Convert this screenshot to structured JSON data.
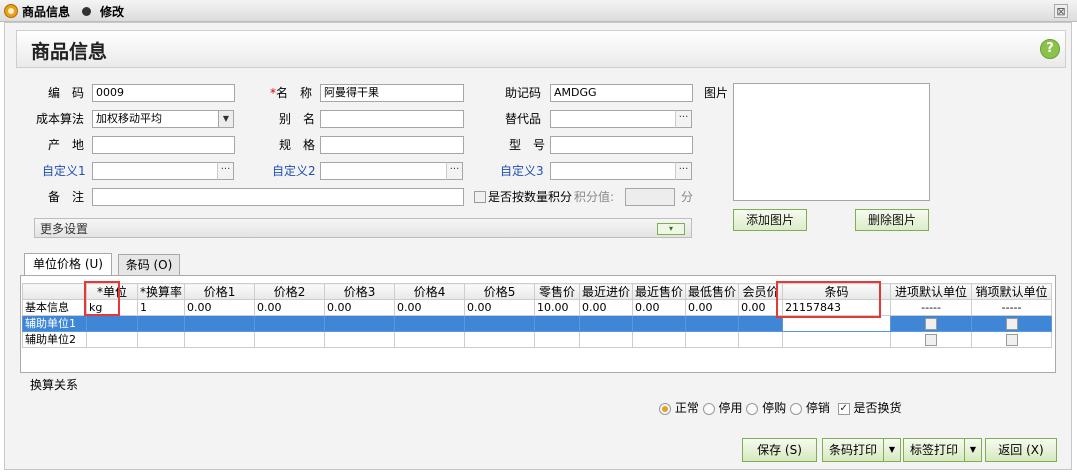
{
  "window": {
    "title": "商品信息",
    "subtitle": "修改",
    "close": "⊠"
  },
  "header": {
    "title": "商品信息",
    "help": "?"
  },
  "form": {
    "code_label": "编　码",
    "code_value": "0009",
    "name_required": "*",
    "name_label": "名　称",
    "name_value": "阿曼得干果",
    "mnemonic_label": "助记码",
    "mnemonic_value": "AMDGG",
    "picture_label": "图片",
    "cost_label": "成本算法",
    "cost_value": "加权移动平均",
    "alias_label": "别　名",
    "alias_value": "",
    "substitute_label": "替代品",
    "substitute_value": "",
    "origin_label": "产　地",
    "origin_value": "",
    "spec_label": "规　格",
    "spec_value": "",
    "model_label": "型　号",
    "model_value": "",
    "custom1_label": "自定义1",
    "custom1_value": "",
    "custom2_label": "自定义2",
    "custom2_value": "",
    "custom3_label": "自定义3",
    "custom3_value": "",
    "remark_label": "备　注",
    "remark_value": "",
    "points_check_label": "是否按数量积分",
    "points_value_label": "积分值:",
    "points_value": "",
    "points_unit": "分",
    "ellipsis": "···",
    "dropdown": "▼"
  },
  "picture": {
    "add_label": "添加图片",
    "delete_label": "删除图片"
  },
  "more": {
    "label": "更多设置",
    "chevron": "▾"
  },
  "tabs": [
    {
      "label": "单位价格 (U)"
    },
    {
      "label": "条码 (O)"
    }
  ],
  "grid": {
    "columns": [
      "*单位",
      "*换算率",
      "价格1",
      "价格2",
      "价格3",
      "价格4",
      "价格5",
      "零售价",
      "最近进价",
      "最近售价",
      "最低售价",
      "会员价",
      "条码",
      "进项默认单位",
      "销项默认单位"
    ],
    "rows": [
      {
        "name": "基本信息",
        "cells": [
          "kg",
          "1",
          "0.00",
          "0.00",
          "0.00",
          "0.00",
          "0.00",
          "10.00",
          "0.00",
          "0.00",
          "0.00",
          "0.00",
          "21157843",
          "-----",
          "-----"
        ]
      },
      {
        "name": "辅助单位1",
        "cells": [
          "",
          "",
          "",
          "",
          "",
          "",
          "",
          "",
          "",
          "",
          "",
          "",
          "",
          "",
          ""
        ]
      },
      {
        "name": "辅助单位2",
        "cells": [
          "",
          "",
          "",
          "",
          "",
          "",
          "",
          "",
          "",
          "",
          "",
          "",
          "",
          "",
          ""
        ]
      }
    ]
  },
  "conversion_label": "换算关系",
  "status": {
    "options": [
      "正常",
      "停用",
      "停购",
      "停销"
    ],
    "selected": "正常",
    "exchange_label": "是否换货",
    "exchange_checked": true
  },
  "footer": {
    "save": "保存 (S)",
    "barcode_print": "条码打印",
    "label_print": "标签打印",
    "back": "返回 (X)"
  },
  "colors": {
    "selection": "#3f87d6",
    "highlight_box": "#e53935",
    "button_border": "#7fae53"
  }
}
